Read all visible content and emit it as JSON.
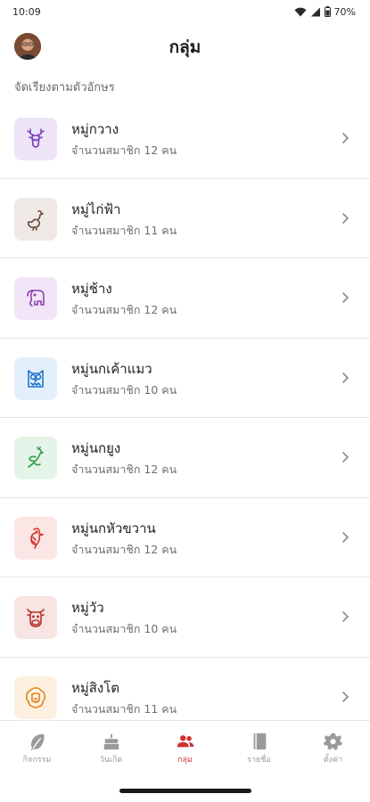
{
  "status": {
    "time": "10:09",
    "battery": "70%"
  },
  "header": {
    "title": "กลุ่ม"
  },
  "sort_label": "จัดเรียงตามตัวอักษร",
  "groups": [
    {
      "name": "หมู่กวาง",
      "count": "จำนวนสมาชิก 12 คน",
      "icon": "deer-icon",
      "color": "#7b3fbf",
      "bg": "#ede4f8"
    },
    {
      "name": "หมู่ไก่ฟ้า",
      "count": "จำนวนสมาชิก 11 คน",
      "icon": "pheasant-icon",
      "color": "#6d4a3a",
      "bg": "#efe9e6"
    },
    {
      "name": "หมู่ช้าง",
      "count": "จำนวนสมาชิก 12 คน",
      "icon": "elephant-icon",
      "color": "#8e3fb0",
      "bg": "#f2e5f7"
    },
    {
      "name": "หมู่นกเค้าแมว",
      "count": "จำนวนสมาชิก 10 คน",
      "icon": "owl-icon",
      "color": "#1e74c9",
      "bg": "#e3effb"
    },
    {
      "name": "หมู่นกยูง",
      "count": "จำนวนสมาชิก 12 คน",
      "icon": "peacock-icon",
      "color": "#2f9e4b",
      "bg": "#e4f4e8"
    },
    {
      "name": "หมู่นกหัวขวาน",
      "count": "จำนวนสมาชิก 12 คน",
      "icon": "woodpecker-icon",
      "color": "#d8312c",
      "bg": "#fbe6e5"
    },
    {
      "name": "หมู่วัว",
      "count": "จำนวนสมาชิก 10 คน",
      "icon": "cow-icon",
      "color": "#b8312c",
      "bg": "#f7e4e3"
    },
    {
      "name": "หมู่สิงโต",
      "count": "จำนวนสมาชิก 11 คน",
      "icon": "lion-icon",
      "color": "#e0851a",
      "bg": "#fdf0e0"
    }
  ],
  "nav": [
    {
      "label": "กิจกรรม",
      "icon": "leaf-icon",
      "active": false
    },
    {
      "label": "วันเกิด",
      "icon": "cake-icon",
      "active": false
    },
    {
      "label": "กลุ่ม",
      "icon": "people-icon",
      "active": true
    },
    {
      "label": "รายชื่อ",
      "icon": "book-icon",
      "active": false
    },
    {
      "label": "ตั้งค่า",
      "icon": "gear-icon",
      "active": false
    }
  ],
  "colors": {
    "accent": "#d32f2f",
    "inactive": "#9a9a9a"
  }
}
